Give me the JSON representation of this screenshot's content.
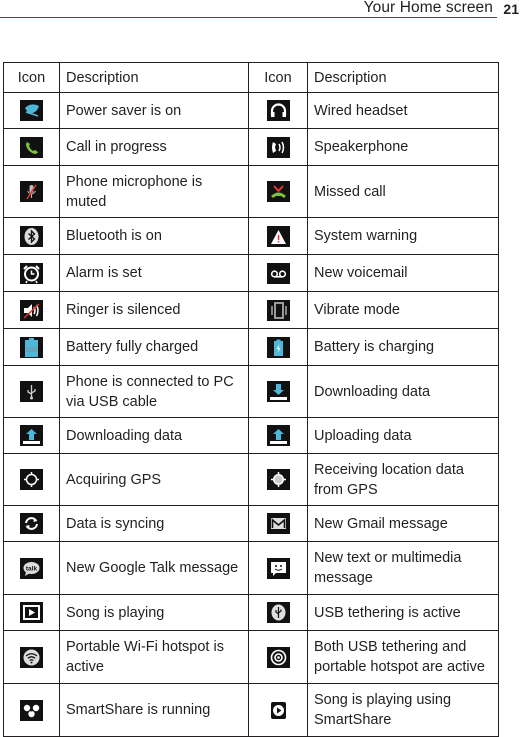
{
  "header": {
    "title": "Your Home screen",
    "page_number": "21",
    "accent_color": "#b5144b"
  },
  "table": {
    "columns": [
      "Icon",
      "Description",
      "Icon",
      "Description"
    ],
    "rows": [
      {
        "left": {
          "icon": "power-saver-icon",
          "desc": "Power saver is on"
        },
        "right": {
          "icon": "wired-headset-icon",
          "desc": "Wired headset"
        }
      },
      {
        "left": {
          "icon": "call-in-progress-icon",
          "desc": "Call in progress"
        },
        "right": {
          "icon": "speakerphone-icon",
          "desc": "Speakerphone"
        }
      },
      {
        "left": {
          "icon": "microphone-muted-icon",
          "desc": "Phone microphone is muted"
        },
        "right": {
          "icon": "missed-call-icon",
          "desc": "Missed call"
        }
      },
      {
        "left": {
          "icon": "bluetooth-icon",
          "desc": "Bluetooth is on"
        },
        "right": {
          "icon": "system-warning-icon",
          "desc": "System warning"
        }
      },
      {
        "left": {
          "icon": "alarm-icon",
          "desc": "Alarm is set"
        },
        "right": {
          "icon": "voicemail-icon",
          "desc": "New voicemail"
        }
      },
      {
        "left": {
          "icon": "ringer-silenced-icon",
          "desc": "Ringer is silenced"
        },
        "right": {
          "icon": "vibrate-icon",
          "desc": "Vibrate mode"
        }
      },
      {
        "left": {
          "icon": "battery-full-icon",
          "desc": "Battery fully charged"
        },
        "right": {
          "icon": "battery-charging-icon",
          "desc": "Battery is charging"
        }
      },
      {
        "left": {
          "icon": "usb-icon",
          "desc": "Phone is connected to PC via USB cable"
        },
        "right": {
          "icon": "download-icon",
          "desc": "Downloading data"
        }
      },
      {
        "left": {
          "icon": "upload-arrow-icon",
          "desc": "Downloading data"
        },
        "right": {
          "icon": "upload-icon",
          "desc": "Uploading data"
        }
      },
      {
        "left": {
          "icon": "gps-acquiring-icon",
          "desc": "Acquiring GPS"
        },
        "right": {
          "icon": "gps-receiving-icon",
          "desc": "Receiving location data from GPS"
        }
      },
      {
        "left": {
          "icon": "sync-icon",
          "desc": "Data is syncing"
        },
        "right": {
          "icon": "gmail-icon",
          "desc": "New Gmail message"
        }
      },
      {
        "left": {
          "icon": "google-talk-icon",
          "desc": "New Google Talk message"
        },
        "right": {
          "icon": "sms-icon",
          "desc": "New text or multimedia message"
        }
      },
      {
        "left": {
          "icon": "play-icon",
          "desc": "Song is playing"
        },
        "right": {
          "icon": "usb-tethering-icon",
          "desc": "USB tethering is active"
        }
      },
      {
        "left": {
          "icon": "wifi-hotspot-icon",
          "desc": "Portable Wi-Fi hotspot is active"
        },
        "right": {
          "icon": "tethering-hotspot-icon",
          "desc": "Both USB tethering and portable hotspot are active"
        }
      },
      {
        "left": {
          "icon": "smartshare-icon",
          "desc": "SmartShare is running"
        },
        "right": {
          "icon": "smartshare-play-icon",
          "desc": "Song is playing using SmartShare"
        }
      }
    ]
  }
}
